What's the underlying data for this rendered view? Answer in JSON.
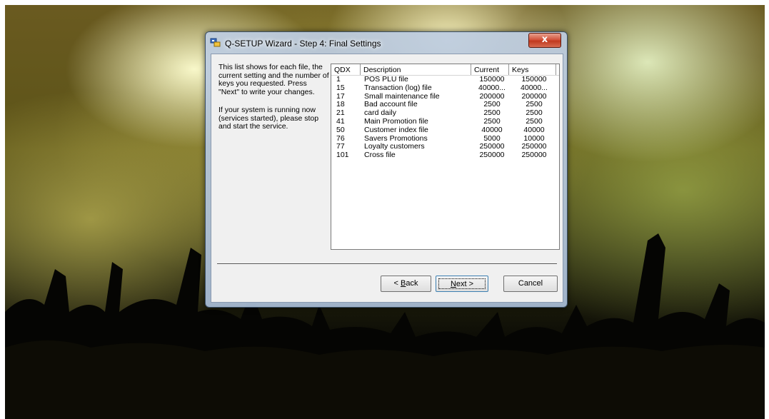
{
  "window": {
    "title": "Q-SETUP Wizard - Step 4: Final Settings",
    "close_label": "x"
  },
  "intro": {
    "paragraph1": "This list shows for each file, the current setting and the number of keys you requested. Press \"Next\" to write your  changes.",
    "paragraph2": "If your system is running now (services started), please stop and start the service."
  },
  "list": {
    "columns": [
      "QDX",
      "Description",
      "Current",
      "Keys"
    ],
    "rows": [
      {
        "qdx": "1",
        "description": "POS PLU file",
        "current": "150000",
        "keys": "150000"
      },
      {
        "qdx": "15",
        "description": "Transaction (log) file",
        "current": "40000...",
        "keys": "40000..."
      },
      {
        "qdx": "17",
        "description": "Small maintenance file",
        "current": "200000",
        "keys": "200000"
      },
      {
        "qdx": "18",
        "description": "Bad account file",
        "current": "2500",
        "keys": "2500"
      },
      {
        "qdx": "21",
        "description": "card daily",
        "current": "2500",
        "keys": "2500"
      },
      {
        "qdx": "41",
        "description": "Main Promotion file",
        "current": "2500",
        "keys": "2500"
      },
      {
        "qdx": "50",
        "description": "Customer index file",
        "current": "40000",
        "keys": "40000"
      },
      {
        "qdx": "76",
        "description": "Savers Promotions",
        "current": "5000",
        "keys": "10000"
      },
      {
        "qdx": "77",
        "description": "Loyalty customers",
        "current": "250000",
        "keys": "250000"
      },
      {
        "qdx": "101",
        "description": "Cross file",
        "current": "250000",
        "keys": "250000"
      }
    ]
  },
  "buttons": {
    "back_mnemonic": "B",
    "back_rest": "ack",
    "back_prefix": "< ",
    "next_mnemonic": "N",
    "next_rest": "ext >",
    "cancel_label": "Cancel"
  },
  "colors": {
    "close_button": "#c0391f",
    "dialog_face": "#f0f0f0",
    "title_glass": "#b4c8e0"
  },
  "icons": {
    "app": "setup-wizard-icon",
    "close": "close-icon"
  }
}
